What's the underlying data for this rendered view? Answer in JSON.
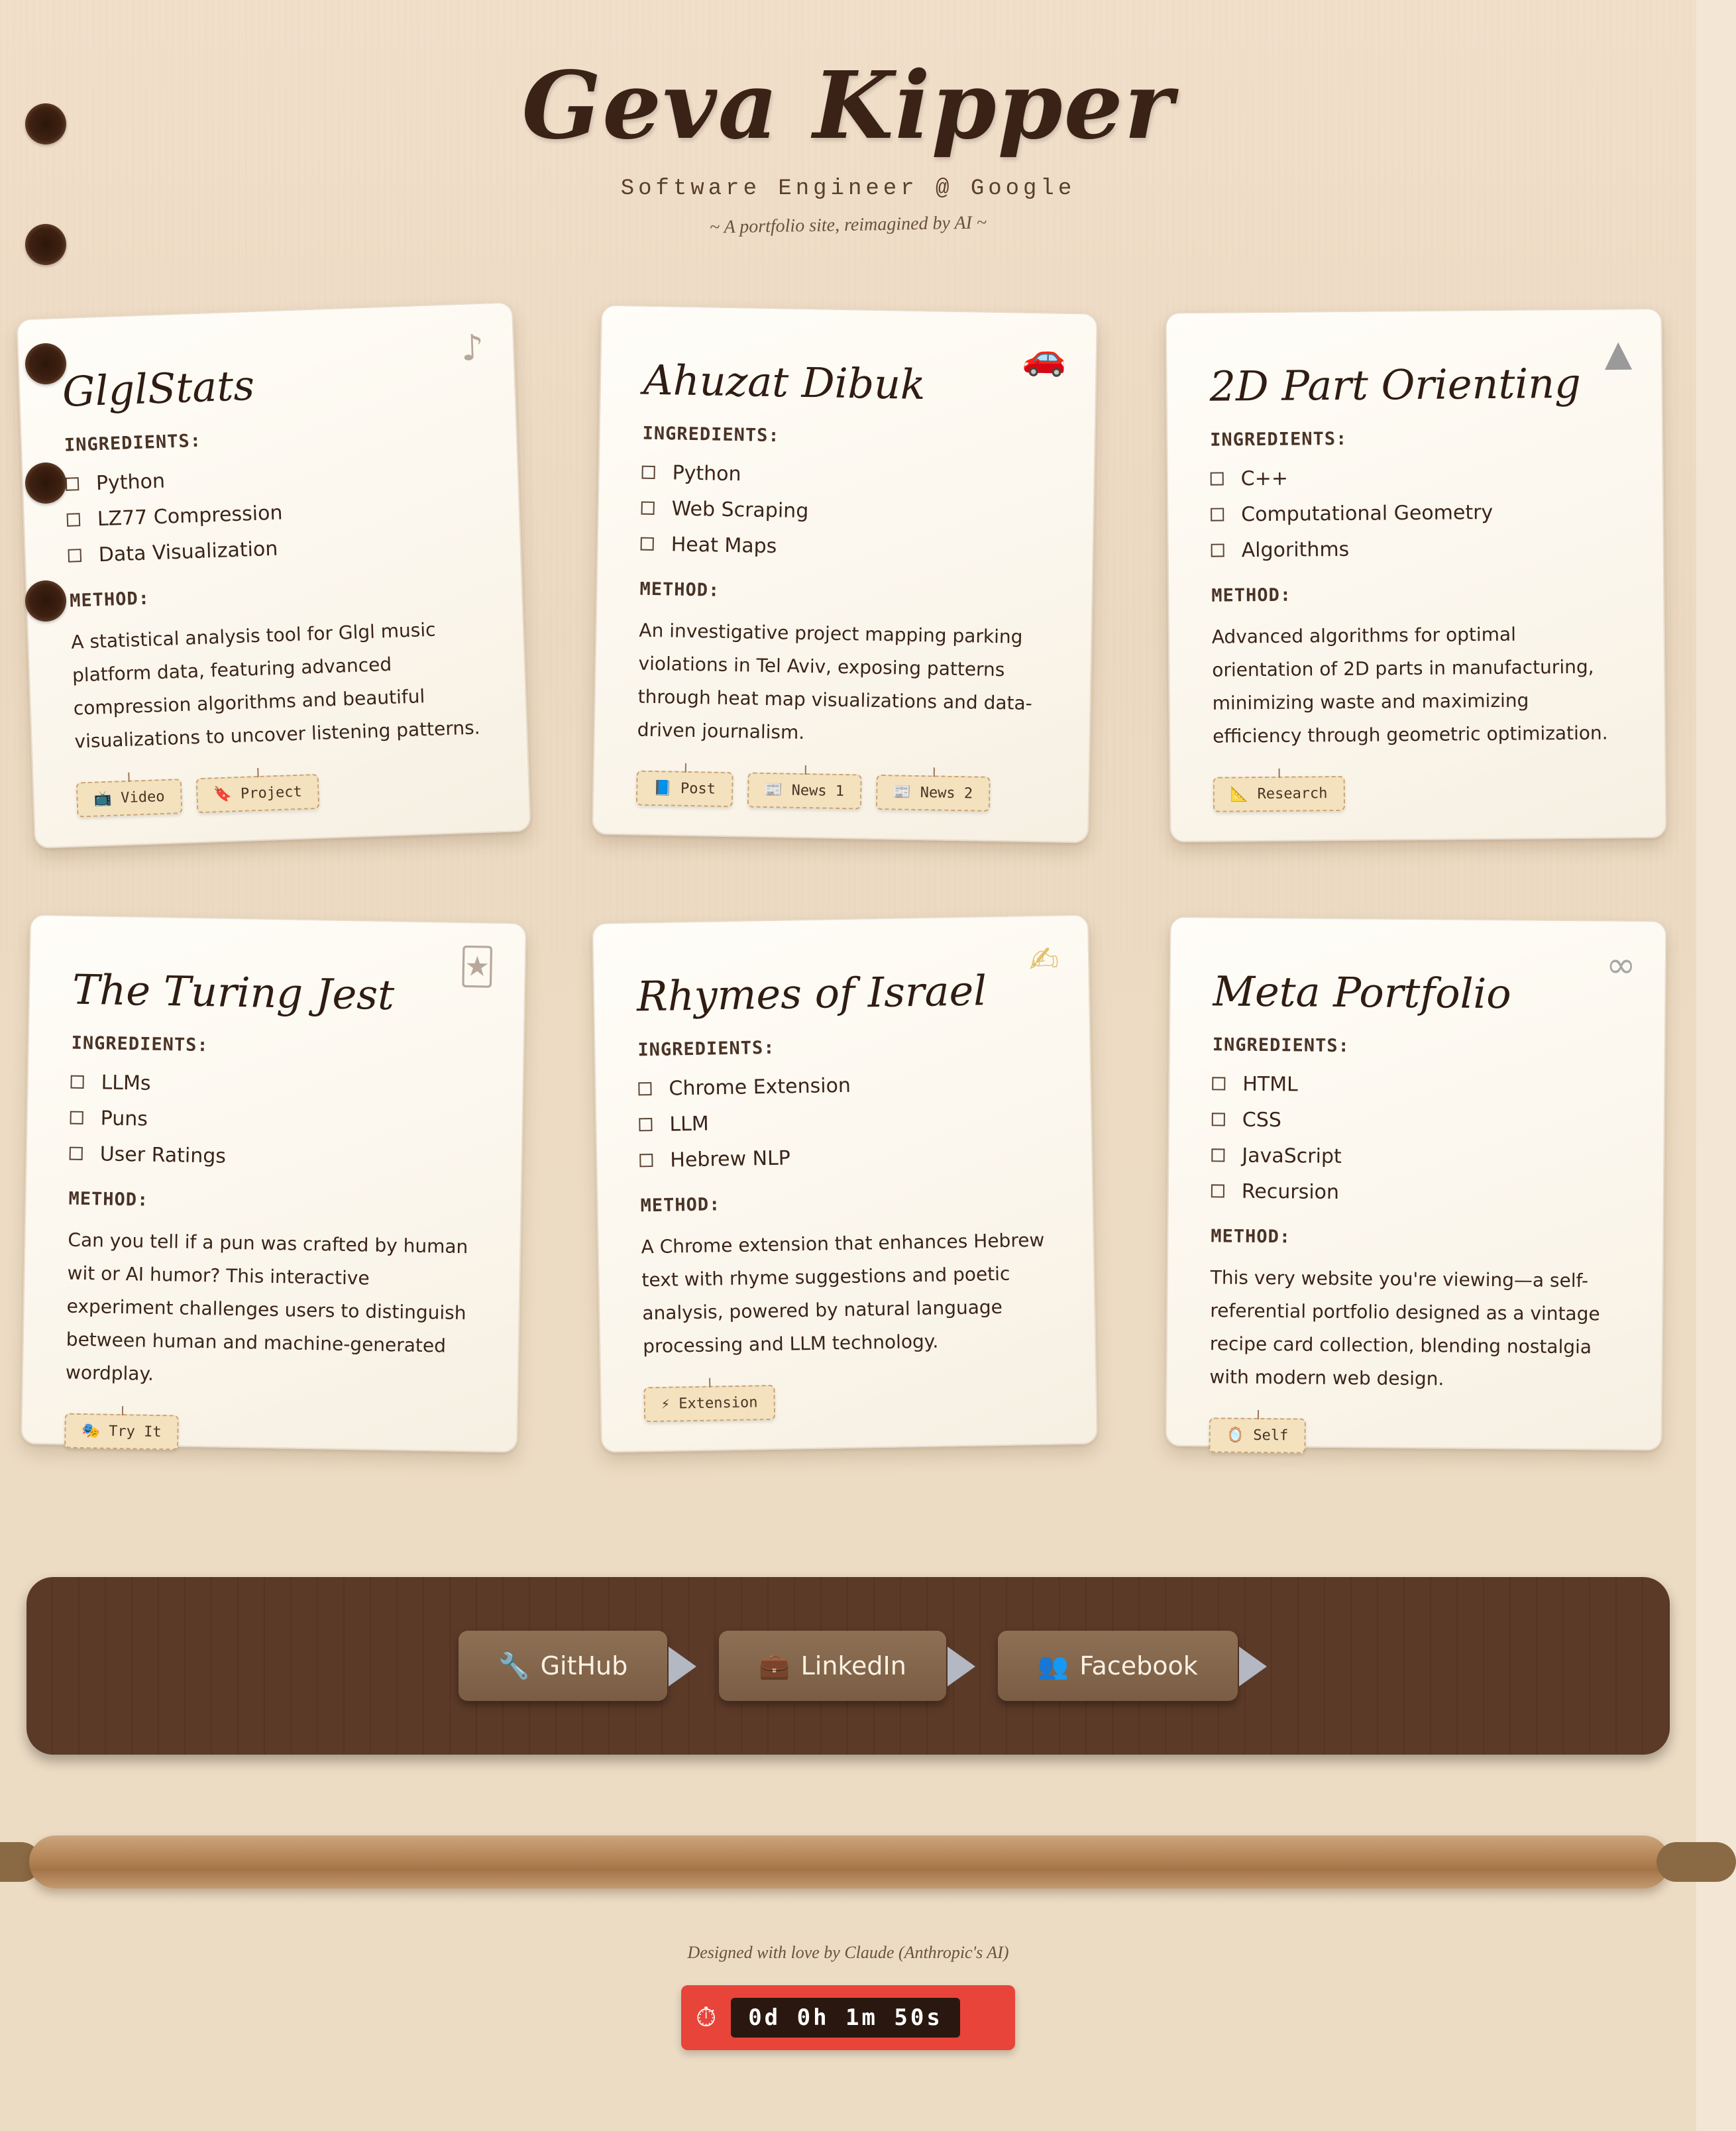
{
  "header": {
    "title": "Geva Kipper",
    "subtitle": "Software Engineer @ Google",
    "tagline": "~ A portfolio site, reimagined by AI ~"
  },
  "labels": {
    "ingredients": "INGREDIENTS:",
    "method": "METHOD:"
  },
  "cards": [
    {
      "title": "GlglStats",
      "icon": "music-note-icon",
      "icon_glyph": "♪",
      "ingredients": [
        "Python",
        "LZ77 Compression",
        "Data Visualization"
      ],
      "method": "A statistical analysis tool for Glgl music platform data, featuring advanced compression algorithms and beautiful visualizations to uncover listening patterns.",
      "tags": [
        {
          "icon": "📺",
          "label": "Video"
        },
        {
          "icon": "🔖",
          "label": "Project"
        }
      ]
    },
    {
      "title": "Ahuzat Dibuk",
      "icon": "car-icon",
      "icon_glyph": "🚗",
      "ingredients": [
        "Python",
        "Web Scraping",
        "Heat Maps"
      ],
      "method": "An investigative project mapping parking violations in Tel Aviv, exposing patterns through heat map visualizations and data-driven journalism.",
      "tags": [
        {
          "icon": "📘",
          "label": "Post"
        },
        {
          "icon": "📰",
          "label": "News 1"
        },
        {
          "icon": "📰",
          "label": "News 2"
        }
      ]
    },
    {
      "title": "2D Part Orienting",
      "icon": "triangle-icon",
      "icon_glyph": "▲",
      "ingredients": [
        "C++",
        "Computational Geometry",
        "Algorithms"
      ],
      "method": "Advanced algorithms for optimal orientation of 2D parts in manufacturing, minimizing waste and maximizing efficiency through geometric optimization.",
      "tags": [
        {
          "icon": "📐",
          "label": "Research"
        }
      ]
    },
    {
      "title": "The Turing Jest",
      "icon": "jester-icon",
      "icon_glyph": "🃏",
      "ingredients": [
        "LLMs",
        "Puns",
        "User Ratings"
      ],
      "method": "Can you tell if a pun was crafted by human wit or AI humor? This interactive experiment challenges users to distinguish between human and machine-generated wordplay.",
      "tags": [
        {
          "icon": "🎭",
          "label": "Try It"
        }
      ]
    },
    {
      "title": "Rhymes of Israel",
      "icon": "writing-hand-icon",
      "icon_glyph": "✍",
      "ingredients": [
        "Chrome Extension",
        "LLM",
        "Hebrew NLP"
      ],
      "method": "A Chrome extension that enhances Hebrew text with rhyme suggestions and poetic analysis, powered by natural language processing and LLM technology.",
      "tags": [
        {
          "icon": "⚡",
          "label": "Extension"
        }
      ]
    },
    {
      "title": "Meta Portfolio",
      "icon": "infinity-icon",
      "icon_glyph": "∞",
      "ingredients": [
        "HTML",
        "CSS",
        "JavaScript",
        "Recursion"
      ],
      "method": "This very website you're viewing—a self-referential portfolio designed as a vintage recipe card collection, blending nostalgia with modern web design.",
      "tags": [
        {
          "icon": "🪞",
          "label": "Self"
        }
      ]
    }
  ],
  "links": [
    {
      "icon": "🔧",
      "label": "GitHub"
    },
    {
      "icon": "💼",
      "label": "LinkedIn"
    },
    {
      "icon": "👥",
      "label": "Facebook"
    }
  ],
  "footer": {
    "credit": "Designed with love by Claude (Anthropic's AI)",
    "timer_icon": "⏱",
    "timer": "0d 0h 1m 50s"
  },
  "colors": {
    "background": "#efdcc5",
    "card": "#fdf9f1",
    "footer_bar": "#5c3a28",
    "timer": "#e8443a",
    "tag": "#f4e1bd"
  }
}
